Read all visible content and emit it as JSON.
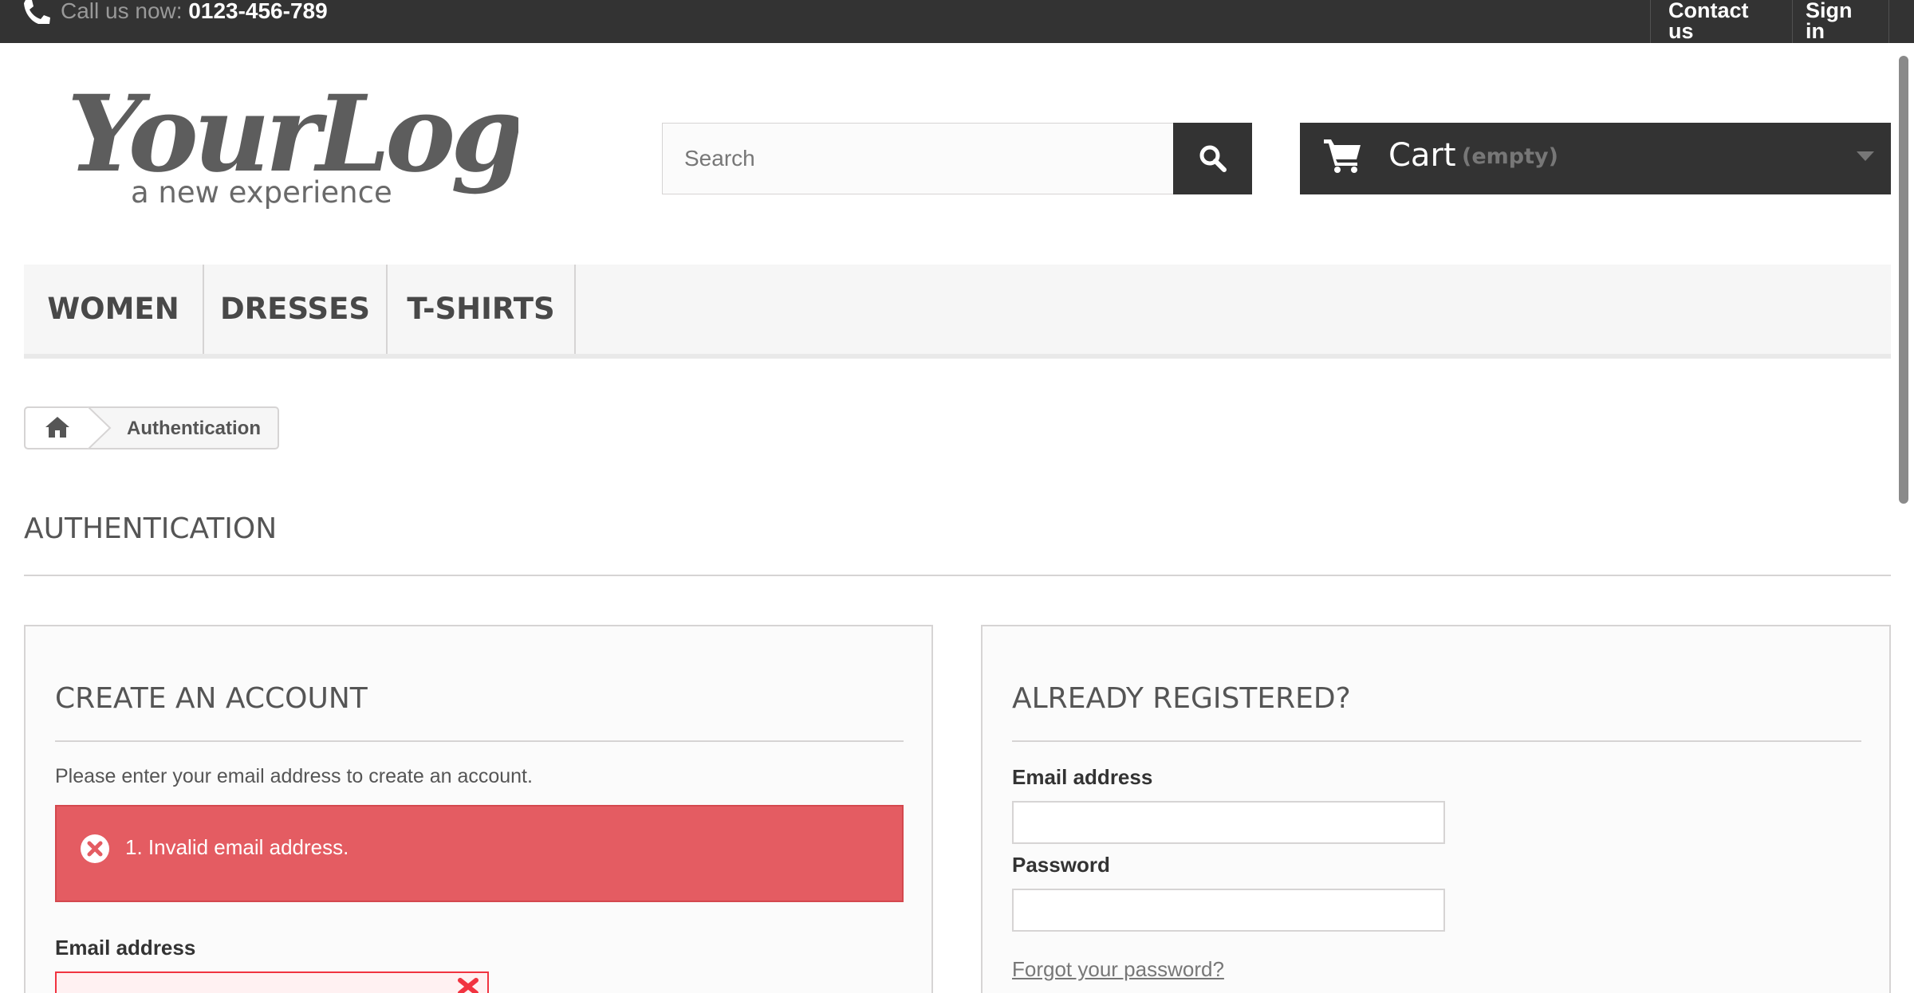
{
  "topbar": {
    "call_label": "Call us now:",
    "phone": "0123-456-789",
    "contact_label": "Contact us",
    "signin_label": "Sign in"
  },
  "logo": {
    "main_text": "YourLogo",
    "tagline": "a new experience"
  },
  "search": {
    "placeholder": "Search"
  },
  "cart": {
    "label": "Cart",
    "status": "(empty)"
  },
  "menu": {
    "items": [
      {
        "label": "WOMEN"
      },
      {
        "label": "DRESSES"
      },
      {
        "label": "T-SHIRTS"
      }
    ]
  },
  "breadcrumb": {
    "current": "Authentication"
  },
  "page": {
    "heading": "AUTHENTICATION"
  },
  "create_account": {
    "title": "CREATE AN ACCOUNT",
    "intro": "Please enter your email address to create an account.",
    "error": "1. Invalid email address.",
    "email_label": "Email address",
    "email_value": ""
  },
  "login": {
    "title": "ALREADY REGISTERED?",
    "email_label": "Email address",
    "password_label": "Password",
    "forgot_label": "Forgot your password?"
  },
  "colors": {
    "dark": "#333333",
    "error_red": "#e45c62",
    "border": "#d6d4d4"
  }
}
